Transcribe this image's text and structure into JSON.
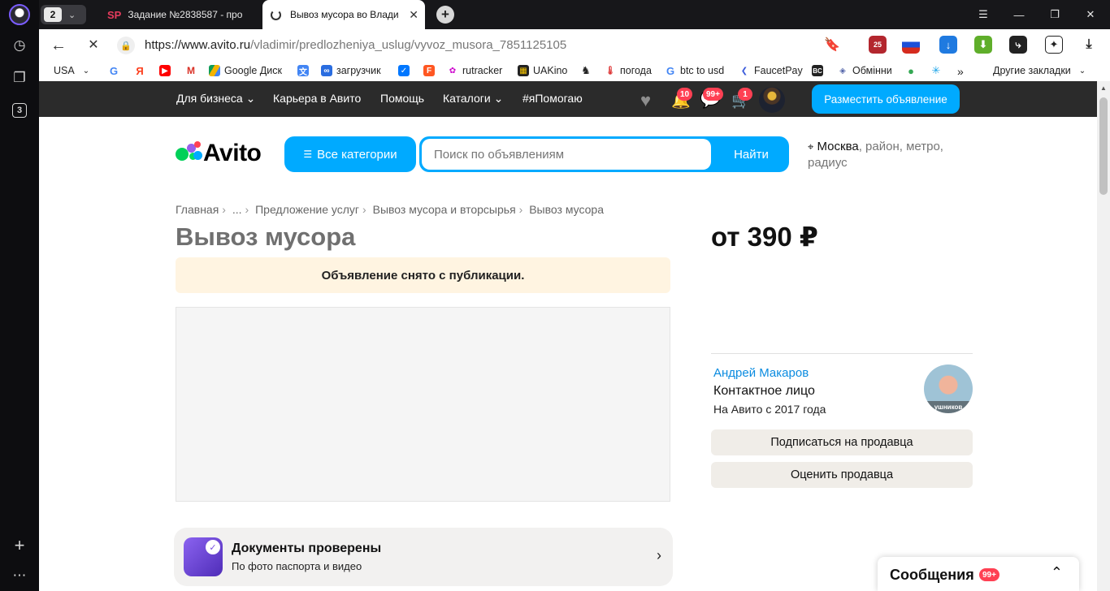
{
  "browser": {
    "tab_count": "2",
    "tabs": [
      {
        "title": "Задание №2838587 - про",
        "favicon": "SP"
      },
      {
        "title": "Вывоз мусора во Влади"
      }
    ],
    "url_host": "https://www.avito.ru",
    "url_path": "/vladimir/predlozheniya_uslug/vyvoz_musora_7851125105",
    "sidebar_badge": "3",
    "ext_calendar_num": "25",
    "bookmarks": [
      {
        "label": "USA",
        "icon": "dropdown"
      },
      {
        "label": "",
        "icon": "G"
      },
      {
        "label": "",
        "icon": "Я"
      },
      {
        "label": "",
        "icon": "youtube-icon"
      },
      {
        "label": "",
        "icon": "gmail-icon"
      },
      {
        "label": "Google Диск",
        "icon": "drive-icon"
      },
      {
        "label": "",
        "icon": "translate-icon"
      },
      {
        "label": "загрузчик",
        "icon": "loader-icon"
      },
      {
        "label": "",
        "icon": "vk-icon"
      },
      {
        "label": "",
        "icon": "F"
      },
      {
        "label": "rutracker",
        "icon": "rutracker-icon"
      },
      {
        "label": "UAKino",
        "icon": "uakino-icon"
      },
      {
        "label": "",
        "icon": "chess-icon"
      },
      {
        "label": "погода",
        "icon": "weather-icon"
      },
      {
        "label": "btc to usd",
        "icon": "G"
      },
      {
        "label": "FaucetPay",
        "icon": "faucet-icon"
      },
      {
        "label": "",
        "icon": "BC"
      },
      {
        "label": "Обмінни",
        "icon": "exchange-icon"
      }
    ],
    "bookmarks_other": "Другие закладки",
    "bookmarks_more": "»"
  },
  "avito": {
    "topnav": [
      "Для бизнеса",
      "Карьера в Авито",
      "Помощь",
      "Каталоги",
      "#яПомогаю"
    ],
    "badges": {
      "notifications": "10",
      "messages": "99+",
      "cart": "1"
    },
    "post_button": "Разместить объявление",
    "logo_text": "Avito",
    "categories_button": "Все категории",
    "search_placeholder": "Поиск по объявлениям",
    "search_button": "Найти",
    "location_city": "Москва",
    "location_rest": ", район, метро, радиус",
    "breadcrumbs": [
      "Главная",
      "...",
      "Предложение услуг",
      "Вывоз мусора и вторсырья",
      "Вывоз мусора"
    ],
    "title": "Вывоз мусора",
    "notice": "Объявление снято с публикации.",
    "price": "от 390 ₽",
    "seller": {
      "name": "Андрей Макаров",
      "role": "Контактное лицо",
      "since": "На Авито с 2017 года",
      "avatar_caption": "ушников"
    },
    "subscribe_button": "Подписаться на продавца",
    "rate_button": "Оценить продавца",
    "docs_title": "Документы проверены",
    "docs_subtitle": "По фото паспорта и видео",
    "messages_title": "Сообщения",
    "messages_badge": "99+"
  },
  "colors": {
    "accent": "#00aaff",
    "notice_bg": "#fff4e1",
    "badge": "#ff4053"
  }
}
